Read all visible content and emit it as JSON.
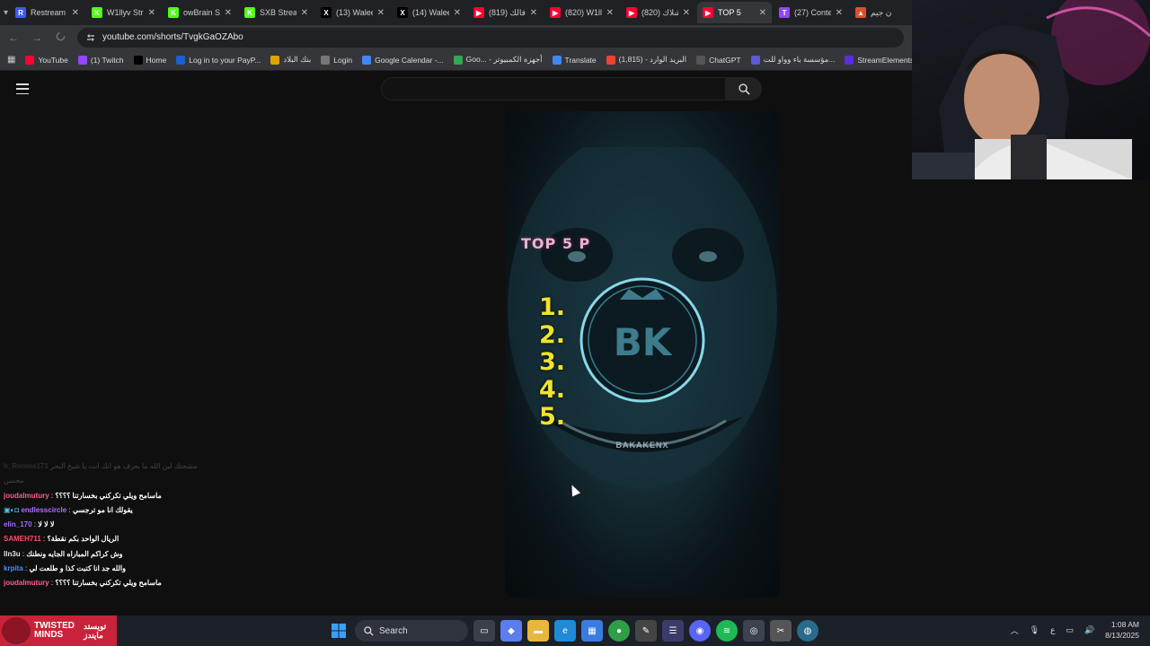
{
  "browser": {
    "tabs": [
      {
        "title": "Restream",
        "icon": "restream-icon",
        "color": "#3d5afe",
        "letter": "R"
      },
      {
        "title": "W1llyv Str",
        "icon": "kick-icon",
        "color": "#53fc18",
        "letter": "K"
      },
      {
        "title": "owBrain St",
        "icon": "kick-icon",
        "color": "#53fc18",
        "letter": "K"
      },
      {
        "title": "SXB Strean",
        "icon": "kick-icon",
        "color": "#53fc18",
        "letter": "K"
      },
      {
        "title": "(13) Walee",
        "icon": "x-icon",
        "color": "#000000",
        "letter": "X"
      },
      {
        "title": "(14) Walee",
        "icon": "x-icon",
        "color": "#000000",
        "letter": "X"
      },
      {
        "title": "(819) فالك",
        "icon": "youtube-icon",
        "color": "#ff0033",
        "letter": "▶"
      },
      {
        "title": "(820) W1ll",
        "icon": "youtube-icon",
        "color": "#ff0033",
        "letter": "▶"
      },
      {
        "title": "(820) شلاك",
        "icon": "youtube-icon",
        "color": "#ff0033",
        "letter": "▶"
      },
      {
        "title": "TOP 5",
        "icon": "youtube-icon",
        "color": "#ff0033",
        "letter": "▶",
        "active": true
      },
      {
        "title": "(27) Conte",
        "icon": "twitch-icon",
        "color": "#9146ff",
        "letter": "T"
      },
      {
        "title": "ن جيم",
        "icon": "app-icon",
        "color": "#e04e2e",
        "letter": "▲"
      }
    ],
    "url": "youtube.com/shorts/TvgkGaOZAbo",
    "bookmarks": [
      {
        "label": "YouTube",
        "color": "#ff0033"
      },
      {
        "label": "(1) Twitch",
        "color": "#9146ff"
      },
      {
        "label": "Home",
        "color": "#000000"
      },
      {
        "label": "Log in to your PayP...",
        "color": "#1f5fd1"
      },
      {
        "label": "بنك البلاد",
        "color": "#e0a400"
      },
      {
        "label": "Login",
        "color": "#777777"
      },
      {
        "label": "Google Calendar -...",
        "color": "#4285f4"
      },
      {
        "label": "Goo... - أجهزة الكمبيوتر",
        "color": "#34a853"
      },
      {
        "label": "Translate",
        "color": "#4285f4"
      },
      {
        "label": "البريد الوارد - (1,815)",
        "color": "#ea4335"
      },
      {
        "label": "ChatGPT",
        "color": "#555555"
      },
      {
        "label": "مؤسسة باء وواو للت...",
        "color": "#5b5bd6"
      },
      {
        "label": "StreamElements - M",
        "color": "#5b2ddc"
      }
    ]
  },
  "youtube": {
    "search_placeholder": "",
    "video": {
      "overlay_title": "TOP 5 P",
      "list_numbers": [
        "1.",
        "2.",
        "3.",
        "4.",
        "5."
      ],
      "watermark": "BAKAKENX"
    }
  },
  "chat": {
    "faded_rows": [
      {
        "user": "h_Rooms171",
        "msg": "مشحنك لين الله ما يعرف هو انك انت يا شيخ البحر",
        "color": "#888888"
      },
      {
        "user": "",
        "msg": "محسن",
        "color": "#888888"
      }
    ],
    "rows": [
      {
        "user": "joudalmutury",
        "msg": "ماسامح ويلي تكركني بخسارتنا ؟؟؟؟",
        "color": "#ff5c8a"
      },
      {
        "user": "endlesscircle",
        "msg": "يقولك انا مو ترجسي",
        "color": "#b26bff",
        "badges": true
      },
      {
        "user": "elin_170",
        "msg": "لا لا لا",
        "color": "#9b6bff"
      },
      {
        "user": "SAMEH711",
        "msg": "الريال الواحد بكم نقطة؟",
        "color": "#ff4b6b"
      },
      {
        "user": "lln3u",
        "msg": "وش كراكم المباراه الجايه ونطنك",
        "color": "#e0e0e0"
      },
      {
        "user": "krpita",
        "msg": "والله جد انا كتبت كذا و طلعت لي",
        "color": "#4d8cff"
      },
      {
        "user": "joudalmutury",
        "msg": "ماسامح ويلي تكركني بخسارتنا ؟؟؟؟",
        "color": "#ff5c8a"
      }
    ]
  },
  "overlay": {
    "logo_line1": "TWISTED",
    "logo_line2": "MINDS",
    "logo_arabic": "تويستد\nمايندز",
    "brand_color": "#c8233a"
  },
  "taskbar": {
    "search_label": "Search",
    "language": "ع",
    "time": "1:08 AM",
    "date": "8/13/2025"
  }
}
